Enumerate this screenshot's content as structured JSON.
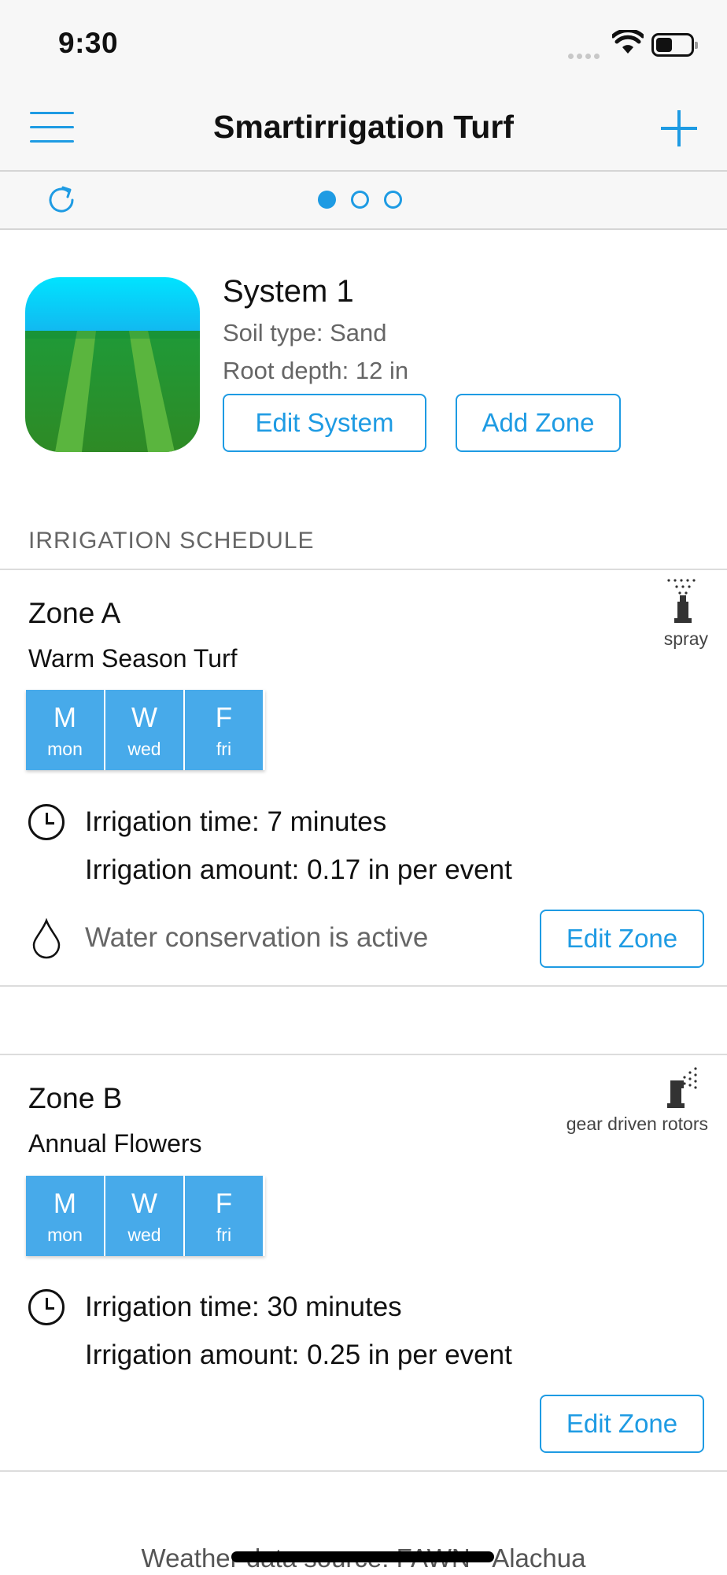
{
  "status_bar": {
    "time": "9:30"
  },
  "nav": {
    "title": "Smartirrigation Turf"
  },
  "pager": {
    "page_count": 3,
    "current_page": 1
  },
  "system": {
    "name": "System 1",
    "soil_type": "Soil type: Sand",
    "root_depth": "Root depth: 12 in",
    "edit_label": "Edit System",
    "add_zone_label": "Add Zone"
  },
  "schedule": {
    "section_title": "IRRIGATION SCHEDULE",
    "zones": [
      {
        "name": "Zone A",
        "plant": "Warm Season Turf",
        "head_type": "spray",
        "days": [
          {
            "letter": "M",
            "abbr": "mon"
          },
          {
            "letter": "W",
            "abbr": "wed"
          },
          {
            "letter": "F",
            "abbr": "fri"
          }
        ],
        "irrigation_time": "Irrigation time: 7 minutes",
        "irrigation_amount": "Irrigation amount: 0.17 in per event",
        "conservation": "Water conservation is active",
        "edit_label": "Edit Zone"
      },
      {
        "name": "Zone B",
        "plant": "Annual Flowers",
        "head_type": "gear driven rotors",
        "days": [
          {
            "letter": "M",
            "abbr": "mon"
          },
          {
            "letter": "W",
            "abbr": "wed"
          },
          {
            "letter": "F",
            "abbr": "fri"
          }
        ],
        "irrigation_time": "Irrigation time: 30 minutes",
        "irrigation_amount": "Irrigation amount: 0.25 in per event",
        "edit_label": "Edit Zone"
      }
    ]
  },
  "footer": {
    "weather_source": "Weather data source: FAWN - Alachua"
  },
  "colors": {
    "accent": "#1e9be3",
    "day_tile": "#47aaea",
    "secondary_text": "#666666"
  },
  "icons": [
    "menu-icon",
    "plus-icon",
    "refresh-icon",
    "clock-icon",
    "water-drop-icon",
    "spray-head-icon",
    "rotor-head-icon"
  ]
}
